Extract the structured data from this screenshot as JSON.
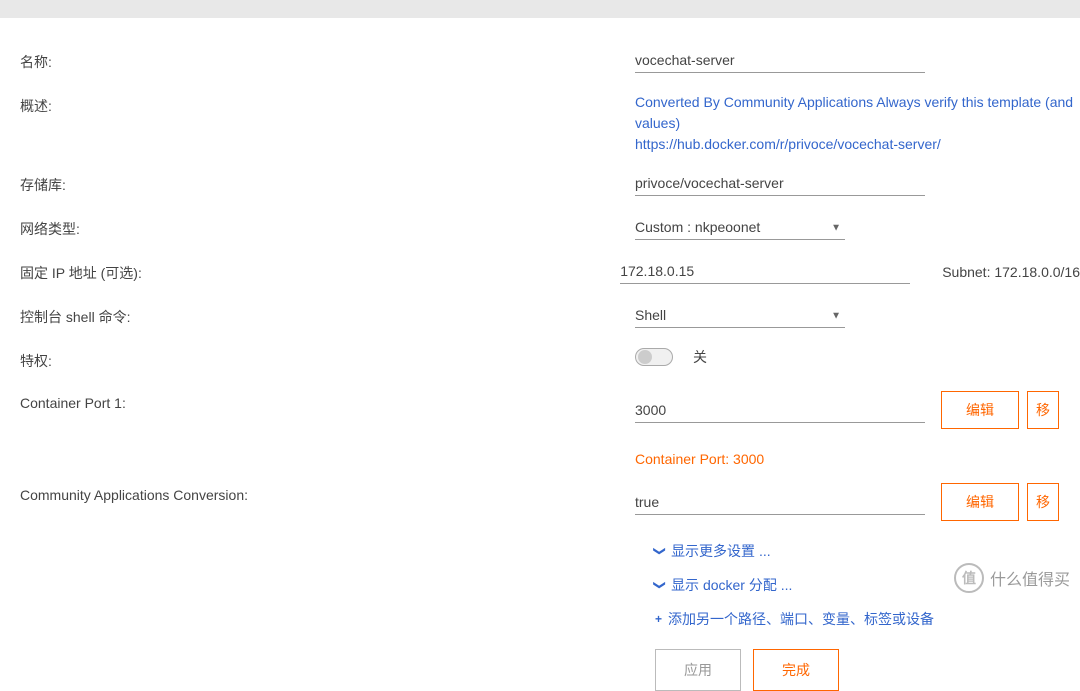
{
  "fields": {
    "name": {
      "label": "名称:",
      "value": "vocechat-server"
    },
    "overview": {
      "label": "概述:",
      "line1": "Converted By Community Applications Always verify this template (and values)",
      "line2": "https://hub.docker.com/r/privoce/vocechat-server/"
    },
    "repository": {
      "label": "存储库:",
      "value": "privoce/vocechat-server"
    },
    "networkType": {
      "label": "网络类型:",
      "value": "Custom : nkpeoonet"
    },
    "fixedIp": {
      "label": "固定 IP 地址 (可选):",
      "value": "172.18.0.15",
      "subnetLabel": "Subnet:",
      "subnetValue": "172.18.0.0/16"
    },
    "consoleShell": {
      "label": "控制台 shell 命令:",
      "value": "Shell"
    },
    "privileged": {
      "label": "特权:",
      "toggleLabel": "关"
    },
    "containerPort": {
      "label": "Container Port 1:",
      "value": "3000",
      "hint": "Container Port: 3000"
    },
    "communityConversion": {
      "label": "Community Applications Conversion:",
      "value": "true"
    }
  },
  "buttons": {
    "edit": "编辑",
    "apply": "应用",
    "done": "完成"
  },
  "actionLinks": {
    "showMoreSettings": "显示更多设置 ...",
    "showDockerAllocation": "显示 docker 分配 ...",
    "addAnother": "添加另一个路径、端口、变量、标签或设备"
  },
  "watermark": {
    "icon": "值",
    "text": "什么值得买"
  }
}
